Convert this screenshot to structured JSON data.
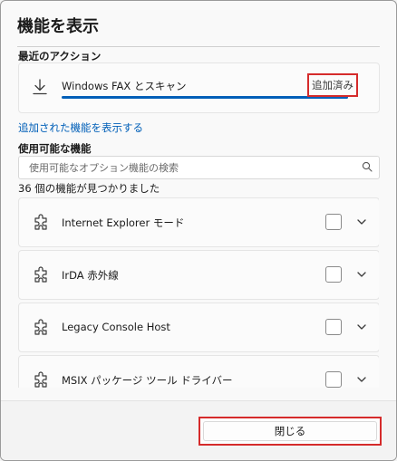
{
  "dialog": {
    "title": "機能を表示",
    "recent_section_label": "最近のアクション",
    "recent_item": {
      "name": "Windows FAX とスキャン",
      "status": "追加済み",
      "progress": 1.0,
      "icon": "download-icon"
    },
    "show_added_link": "追加された機能を表示する",
    "available_section_label": "使用可能な機能",
    "search": {
      "placeholder": "使用可能なオプション機能の検索",
      "value": ""
    },
    "count_text": "36 個の機能が見つかりました",
    "features": [
      {
        "label": "Internet Explorer モード",
        "checked": false
      },
      {
        "label": "IrDA 赤外線",
        "checked": false
      },
      {
        "label": "Legacy Console Host",
        "checked": false
      },
      {
        "label": "MSIX パッケージ ツール ドライバー",
        "checked": false
      }
    ],
    "close_button": "閉じる"
  },
  "colors": {
    "accent": "#005fb8",
    "highlight": "#d52b2b"
  }
}
